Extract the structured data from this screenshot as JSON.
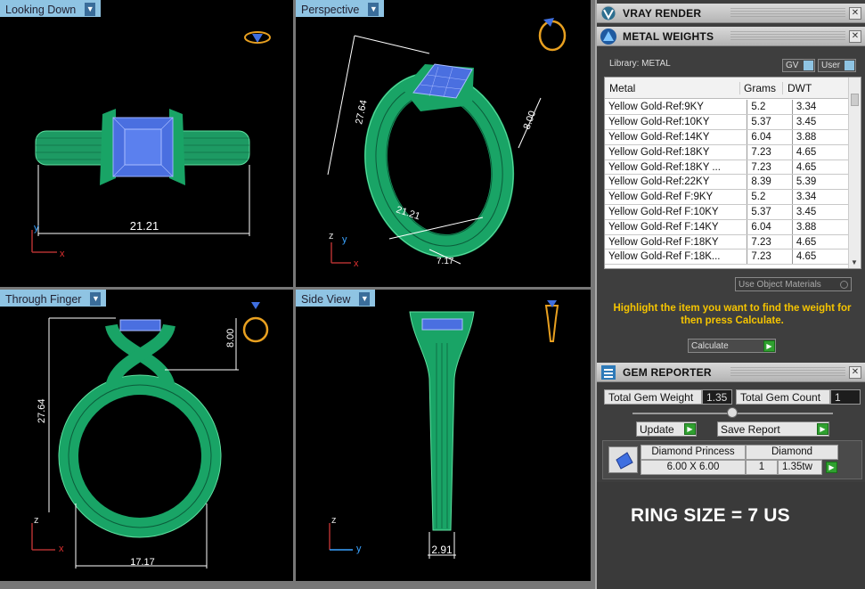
{
  "viewports": {
    "top_left": {
      "label": "Looking Down",
      "dims": [
        "21.21"
      ],
      "axes": [
        "y",
        "x"
      ]
    },
    "top_right": {
      "label": "Perspective",
      "dims": [
        "27.64",
        "8.00",
        "21.21",
        "7.17"
      ],
      "axes": [
        "z",
        "y",
        "x"
      ]
    },
    "bottom_left": {
      "label": "Through Finger",
      "dims": [
        "27.64",
        "8.00",
        "17.17"
      ],
      "axes": [
        "z",
        "x"
      ]
    },
    "bottom_right": {
      "label": "Side View",
      "dims": [
        "2.91"
      ],
      "axes": [
        "z",
        "y"
      ]
    }
  },
  "panel": {
    "vray": {
      "title": "VRAY RENDER"
    },
    "metal": {
      "title": "METAL WEIGHTS",
      "library_label": "Library: METAL",
      "gv_label": "GV",
      "user_label": "User",
      "columns": [
        "Metal",
        "Grams",
        "DWT"
      ],
      "rows": [
        [
          "Yellow Gold-Ref:9KY",
          "5.2",
          "3.34"
        ],
        [
          "Yellow Gold-Ref:10KY",
          "5.37",
          "3.45"
        ],
        [
          "Yellow Gold-Ref:14KY",
          "6.04",
          "3.88"
        ],
        [
          "Yellow Gold-Ref:18KY",
          "7.23",
          "4.65"
        ],
        [
          "Yellow Gold-Ref:18KY ...",
          "7.23",
          "4.65"
        ],
        [
          "Yellow Gold-Ref:22KY",
          "8.39",
          "5.39"
        ],
        [
          "Yellow Gold-Ref F:9KY",
          "5.2",
          "3.34"
        ],
        [
          "Yellow Gold-Ref F:10KY",
          "5.37",
          "3.45"
        ],
        [
          "Yellow Gold-Ref F:14KY",
          "6.04",
          "3.88"
        ],
        [
          "Yellow Gold-Ref F:18KY",
          "7.23",
          "4.65"
        ],
        [
          "Yellow Gold-Ref F:18K...",
          "7.23",
          "4.65"
        ]
      ],
      "use_object_materials": "Use Object Materials",
      "hint": "Highlight the item you want to find the weight for then press Calculate.",
      "calculate": "Calculate"
    },
    "gem": {
      "title": "GEM REPORTER",
      "total_weight_label": "Total Gem Weight",
      "total_weight_value": "1.35",
      "total_count_label": "Total Gem Count",
      "total_count_value": "1",
      "update": "Update",
      "save_report": "Save Report",
      "gem_name": "Diamond Princess",
      "gem_type": "Diamond",
      "gem_size": "6.00 X 6.00",
      "gem_count": "1",
      "gem_weight": "1.35tw"
    },
    "ring_size": "RING SIZE = 7 US",
    "colors": {
      "accent_blue": "#8fc4e3",
      "ring_green": "#1fa068",
      "gem_blue": "#3f6fe0",
      "hint_yellow": "#f5c400",
      "go_green": "#2fa02f"
    }
  }
}
